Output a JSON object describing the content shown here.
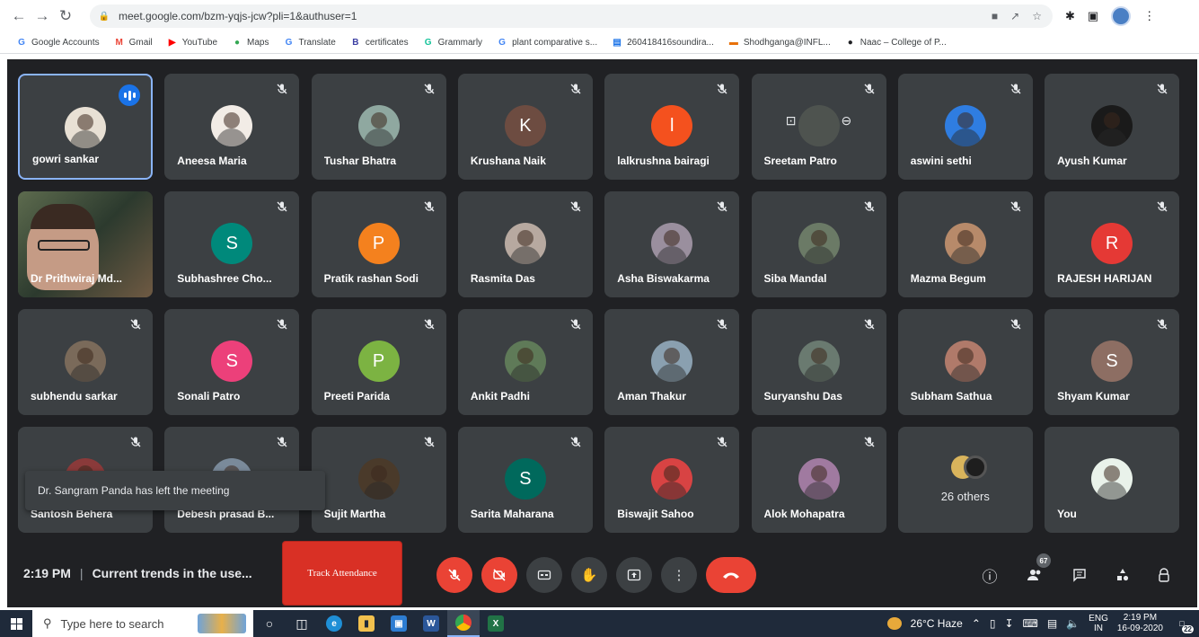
{
  "browser": {
    "url": "meet.google.com/bzm-yqjs-jcw?pli=1&authuser=1",
    "bookmarks": [
      {
        "label": "Google Accounts",
        "icon": "G",
        "color": "#4285f4"
      },
      {
        "label": "Gmail",
        "icon": "M",
        "color": "#ea4335"
      },
      {
        "label": "YouTube",
        "icon": "▶",
        "color": "#ff0000"
      },
      {
        "label": "Maps",
        "icon": "●",
        "color": "#34a853"
      },
      {
        "label": "Translate",
        "icon": "G",
        "color": "#4285f4"
      },
      {
        "label": "certificates",
        "icon": "B",
        "color": "#3c3fa3"
      },
      {
        "label": "Grammarly",
        "icon": "G",
        "color": "#15c39a"
      },
      {
        "label": "plant comparative s...",
        "icon": "G",
        "color": "#4285f4"
      },
      {
        "label": "260418416soundira...",
        "icon": "▤",
        "color": "#1a73e8"
      },
      {
        "label": "Shodhganga@INFL...",
        "icon": "▬",
        "color": "#e8710a"
      },
      {
        "label": "Naac – College of P...",
        "icon": "●",
        "color": "#202124"
      }
    ]
  },
  "meeting": {
    "time": "2:19 PM",
    "separator": "|",
    "title": "Current trends in the use...",
    "track_attendance_label": "Track Attendance",
    "toast": "Dr. Sangram Panda has left the meeting",
    "people_count": "67",
    "others_label": "26 others",
    "participants": [
      {
        "name": "gowri sankar",
        "kind": "photo",
        "color": "#e8e0d4",
        "speaking": true
      },
      {
        "name": "Aneesa Maria",
        "kind": "photo",
        "color": "#f2ece6"
      },
      {
        "name": "Tushar Bhatra",
        "kind": "photo",
        "color": "#8fa8a0"
      },
      {
        "name": "Krushana Naik",
        "kind": "letter",
        "letter": "K",
        "color": "#6d4c41"
      },
      {
        "name": "lalkrushna bairagi",
        "kind": "letter",
        "letter": "l",
        "color": "#f4511e"
      },
      {
        "name": "Sreetam Patro",
        "kind": "pinned",
        "color": "#5a6058"
      },
      {
        "name": "aswini sethi",
        "kind": "photo",
        "color": "#2f7de1"
      },
      {
        "name": "Ayush Kumar",
        "kind": "photo",
        "color": "#1a1a1a"
      },
      {
        "name": "Dr Prithwiraj Md...",
        "kind": "video"
      },
      {
        "name": "Subhashree Cho...",
        "kind": "letter",
        "letter": "S",
        "color": "#00897b"
      },
      {
        "name": "Pratik rashan Sodi",
        "kind": "letter",
        "letter": "P",
        "color": "#f4811e"
      },
      {
        "name": "Rasmita Das",
        "kind": "photo",
        "color": "#b7a9a0"
      },
      {
        "name": "Asha Biswakarma",
        "kind": "photo",
        "color": "#9a8f9e"
      },
      {
        "name": "Siba Mandal",
        "kind": "photo",
        "color": "#6b7a66"
      },
      {
        "name": "Mazma Begum",
        "kind": "photo",
        "color": "#b78a6a"
      },
      {
        "name": "RAJESH HARIJAN",
        "kind": "letter",
        "letter": "R",
        "color": "#e53935"
      },
      {
        "name": "subhendu sarkar",
        "kind": "photo",
        "color": "#7a6a5a"
      },
      {
        "name": "Sonali Patro",
        "kind": "letter",
        "letter": "S",
        "color": "#ec407a"
      },
      {
        "name": "Preeti Parida",
        "kind": "letter",
        "letter": "P",
        "color": "#7cb342"
      },
      {
        "name": "Ankit Padhi",
        "kind": "photo",
        "color": "#5f7a58"
      },
      {
        "name": "Aman Thakur",
        "kind": "photo",
        "color": "#8aa0b0"
      },
      {
        "name": "Suryanshu Das",
        "kind": "photo",
        "color": "#6a7a70"
      },
      {
        "name": "Subham Sathua",
        "kind": "photo",
        "color": "#b07a6a"
      },
      {
        "name": "Shyam Kumar",
        "kind": "letter",
        "letter": "S",
        "color": "#8d6e63"
      },
      {
        "name": "Santosh Behera",
        "kind": "photo",
        "color": "#8a3a3a"
      },
      {
        "name": "Debesh prasad B...",
        "kind": "photo",
        "color": "#7a8a9a"
      },
      {
        "name": "Sujit Martha",
        "kind": "photo",
        "color": "#4a3a2a"
      },
      {
        "name": "Sarita Maharana",
        "kind": "letter",
        "letter": "S",
        "color": "#00695c"
      },
      {
        "name": "Biswajit Sahoo",
        "kind": "photo",
        "color": "#d84343"
      },
      {
        "name": "Alok Mohapatra",
        "kind": "photo",
        "color": "#a07aa0"
      },
      {
        "name": "",
        "kind": "others"
      },
      {
        "name": "You",
        "kind": "photo",
        "color": "#e9f2ea"
      }
    ]
  },
  "taskbar": {
    "search_placeholder": "Type here to search",
    "weather": "26°C  Haze",
    "lang_top": "ENG",
    "lang_bottom": "IN",
    "clock_time": "2:19 PM",
    "clock_date": "16-09-2020",
    "notifications": "22"
  }
}
